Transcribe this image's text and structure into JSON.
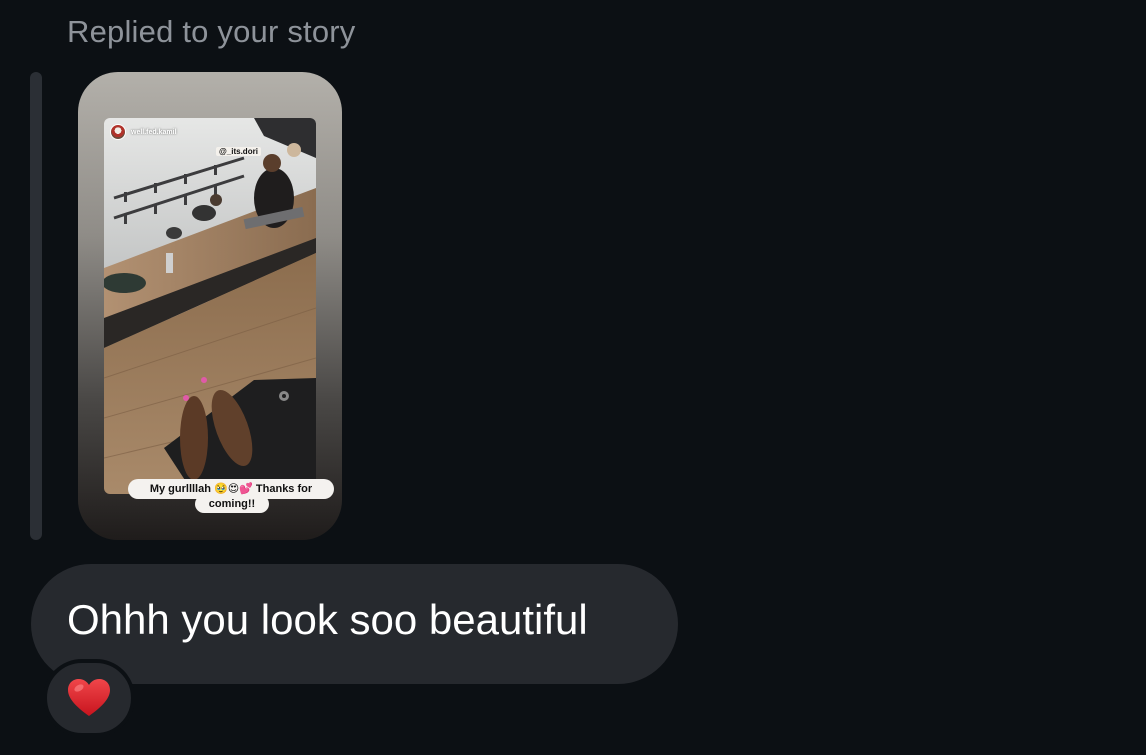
{
  "reply_context": {
    "label": "Replied to your story"
  },
  "story": {
    "username": "well.fed.kamil",
    "mention": "@_its.dori",
    "caption_line1": "My gurllllah 🥹😍💕 Thanks for",
    "caption_line2": "coming!!"
  },
  "message": {
    "text": "Ohhh you look soo beautiful"
  },
  "reaction": {
    "icon": "red-heart-icon",
    "color": "#e0282e"
  },
  "colors": {
    "background": "#0c1014",
    "bubble": "#26292e",
    "label_gray": "#8e939a"
  }
}
